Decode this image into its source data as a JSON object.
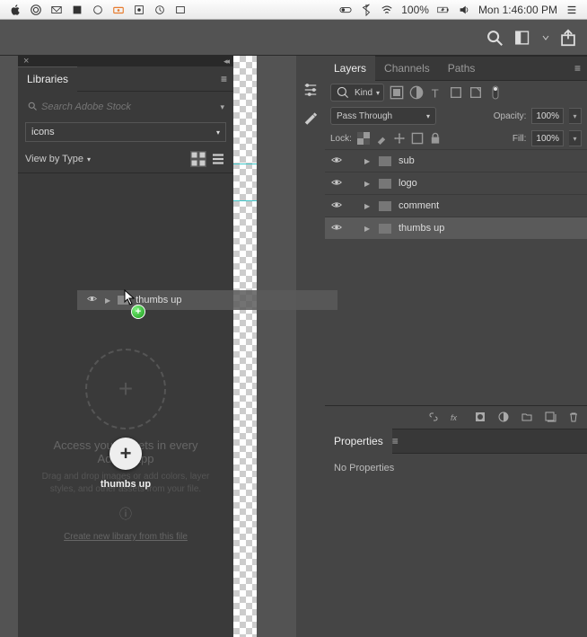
{
  "menubar": {
    "battery_pct": "100%",
    "clock": "Mon 1:46:00 PM"
  },
  "libraries": {
    "tab_label": "Libraries",
    "search_placeholder": "Search Adobe Stock",
    "library_selected": "icons",
    "view_label": "View by Type",
    "help_h": "Access your assets in every Adobe app",
    "help_p": "Drag and drop images or add colors, layer styles, and other assets from your file.",
    "create_link": "Create new library from this file",
    "thumb_label": "thumbs up",
    "drag_label": "thumbs up"
  },
  "layers": {
    "tabs": [
      "Layers",
      "Channels",
      "Paths"
    ],
    "kind_label": "Kind",
    "blend_mode": "Pass Through",
    "opacity_label": "Opacity:",
    "opacity_value": "100%",
    "lock_label": "Lock:",
    "fill_label": "Fill:",
    "fill_value": "100%",
    "items": [
      {
        "name": "sub"
      },
      {
        "name": "logo"
      },
      {
        "name": "comment"
      },
      {
        "name": "thumbs up"
      }
    ]
  },
  "properties": {
    "tab_label": "Properties",
    "body": "No Properties"
  }
}
